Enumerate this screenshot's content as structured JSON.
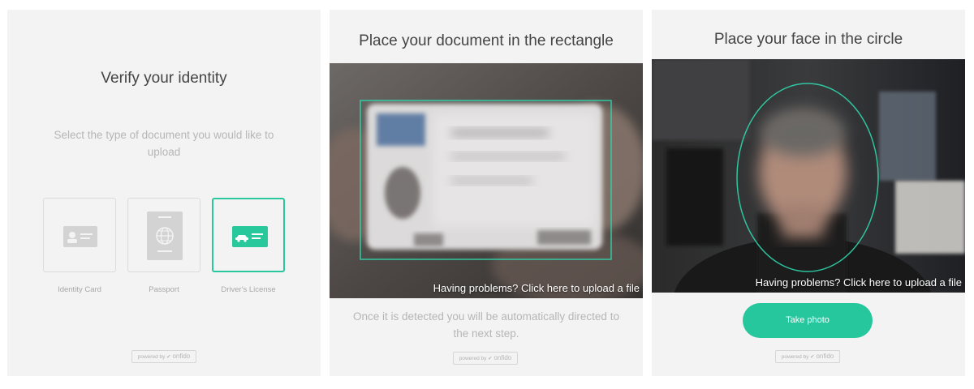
{
  "panel1": {
    "title": "Verify your identity",
    "subtitle": "Select the type of document you would like to upload",
    "options": [
      {
        "label": "Identity Card",
        "icon": "id-card-icon",
        "selected": false
      },
      {
        "label": "Passport",
        "icon": "passport-icon",
        "selected": false
      },
      {
        "label": "Driver's License",
        "icon": "drivers-license-icon",
        "selected": true
      }
    ],
    "powered_prefix": "powered by",
    "powered_brand": "onfido"
  },
  "panel2": {
    "title": "Place your document in the rectangle",
    "upload_link": "Having problems? Click here to upload a file",
    "instruction": "Once it is detected you will be automatically directed to the next step.",
    "powered_prefix": "powered by",
    "powered_brand": "onfido"
  },
  "panel3": {
    "title": "Place your face in the circle",
    "upload_link": "Having problems? Click here to upload a file",
    "button": "Take photo",
    "powered_prefix": "powered by",
    "powered_brand": "onfido"
  },
  "colors": {
    "accent": "#28c79c",
    "panel_bg": "#f3f3f3",
    "muted_text": "#b6b6b6"
  }
}
